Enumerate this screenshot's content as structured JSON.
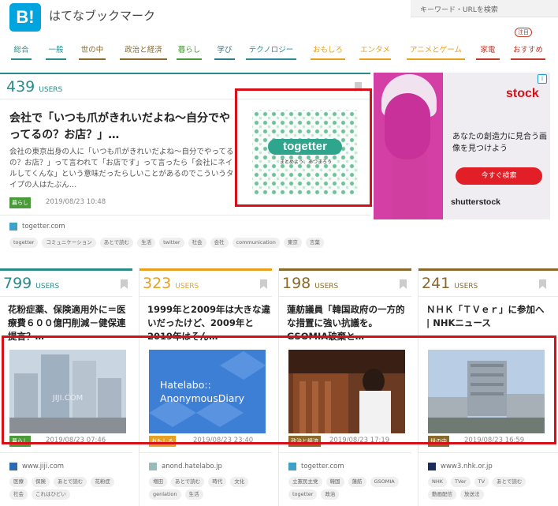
{
  "header": {
    "logo": "B!",
    "title": "はてなブックマーク",
    "search_placeholder": "キーワード・URLを検索"
  },
  "nav": {
    "items": [
      {
        "label": "総合",
        "color": "#2b8a8a"
      },
      {
        "label": "一般",
        "color": "#2b8a8a"
      },
      {
        "label": "世の中",
        "color": "#8a6a2b"
      },
      {
        "label": "政治と経済",
        "color": "#8a6a2b"
      },
      {
        "label": "暮らし",
        "color": "#4a9a3a"
      },
      {
        "label": "学び",
        "color": "#2b7a8a"
      },
      {
        "label": "テクノロジー",
        "color": "#2b8a9a"
      },
      {
        "label": "おもしろ",
        "color": "#e8a020"
      },
      {
        "label": "エンタメ",
        "color": "#e8a020"
      },
      {
        "label": "アニメとゲーム",
        "color": "#e8a020"
      },
      {
        "label": "家電",
        "color": "#c0392b"
      },
      {
        "label": "おすすめ",
        "color": "#c0392b"
      }
    ],
    "badge": "注目"
  },
  "featured": {
    "users": "439",
    "users_label": "USERS",
    "title": "会社で「いつも爪がきれいだよね～自分でやってるの？お店？」…",
    "description": "会社の東京出身の人に「いつも爪がきれいだよね～自分でやってるの？お店？」って言われて「お店です」って言ったら「会社にネイルしてくんな」という意味だったらしいことがあるのでこういうタイプの人はたぶん…",
    "thumb_logo": "togetter",
    "thumb_sub": "まとめよう、あつまろう",
    "category": "暮らし",
    "date": "2019/08/23 10:48",
    "site": "togetter.com",
    "tags": [
      "togetter",
      "コミュニケーション",
      "あとで読む",
      "生活",
      "twitter",
      "社会",
      "会社",
      "communication",
      "東京",
      "言葉"
    ]
  },
  "ad": {
    "brand": "stock",
    "text": "あなたの創造力に見合う画像を見つけよう",
    "button": "今すぐ検索",
    "footer": "shutterstock",
    "info": "i"
  },
  "cards": [
    {
      "users": "799",
      "users_label": "USERS",
      "color": "#2b8a8a",
      "title": "花粉症薬、保険適用外に＝医療費６００億円削減－健保連提言？…",
      "category": "暮らし",
      "date": "2019/08/23 07:46",
      "site": "www.jiji.com",
      "tags": [
        "医療",
        "保険",
        "あとで読む",
        "花粉症",
        "社会",
        "これはひどい"
      ]
    },
    {
      "users": "323",
      "users_label": "USERS",
      "color": "#e8a020",
      "title": "1999年と2009年は大きな違いだったけど、2009年と2019年はそん…",
      "category": "おもしろ",
      "date": "2019/08/23 23:40",
      "site": "anond.hatelabo.jp",
      "thumb_text": "Hatelabo:: AnonymousDiary",
      "tags": [
        "増田",
        "あとで読む",
        "時代",
        "文化",
        "genlation",
        "生活"
      ]
    },
    {
      "users": "198",
      "users_label": "USERS",
      "color": "#8a6a2b",
      "title": "蓮舫議員「韓国政府の一方的な措置に強い抗議を。GSOMIA破棄と…",
      "category": "政治と経済",
      "date": "2019/08/23 17:19",
      "site": "togetter.com",
      "tags": [
        "立憲民主党",
        "韓国",
        "蓮舫",
        "GSOMIA",
        "togetter",
        "政治"
      ]
    },
    {
      "users": "241",
      "users_label": "USERS",
      "color": "#8a6a2b",
      "title": "ＮＨＫ「ＴＶｅｒ」に参加へ | NHKニュース",
      "category": "世の中",
      "date": "2019/08/23 16:59",
      "site": "www3.nhk.or.jp",
      "tags": [
        "NHK",
        "TVer",
        "TV",
        "あとで読む",
        "動画配信",
        "放送法"
      ]
    }
  ]
}
